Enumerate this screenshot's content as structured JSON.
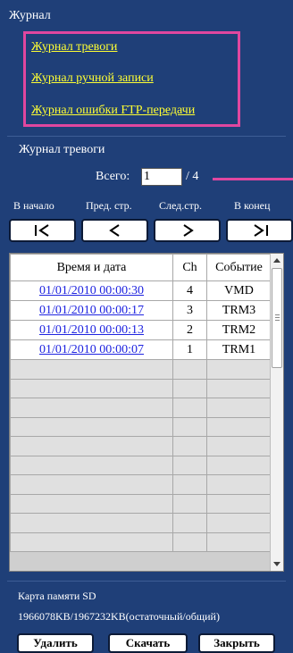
{
  "journal": {
    "title": "Журнал",
    "links": [
      {
        "label": "Журнал тревоги"
      },
      {
        "label": "Журнал ручной записи"
      },
      {
        "label": "Журнал ошибки FTP-передачи"
      }
    ]
  },
  "alarm_log": {
    "title": "Журнал тревоги",
    "total_label": "Всего:",
    "page_value": "1",
    "page_total": "/ 4"
  },
  "nav": {
    "first_label": "В начало",
    "prev_label": "Пред. стр.",
    "next_label": "След.стр.",
    "last_label": "В конец"
  },
  "table": {
    "headers": [
      "Время и дата",
      "Ch",
      "Событие"
    ],
    "rows": [
      [
        "01/01/2010 00:00:30",
        "4",
        "VMD"
      ],
      [
        "01/01/2010 00:00:17",
        "3",
        "TRM3"
      ],
      [
        "01/01/2010 00:00:13",
        "2",
        "TRM2"
      ],
      [
        "01/01/2010 00:00:07",
        "1",
        "TRM1"
      ]
    ]
  },
  "sd_card": {
    "label": "Карта памяти SD",
    "capacity": "1966078KB/1967232KB(остаточный/общий)"
  },
  "actions": {
    "delete_label": "Удалить",
    "download_label": "Скачать",
    "close_label": "Закрыть"
  },
  "colors": {
    "background": "#1f3f78",
    "link": "#ffff33",
    "highlight": "#e0479f",
    "table_link": "#1f24e0"
  }
}
